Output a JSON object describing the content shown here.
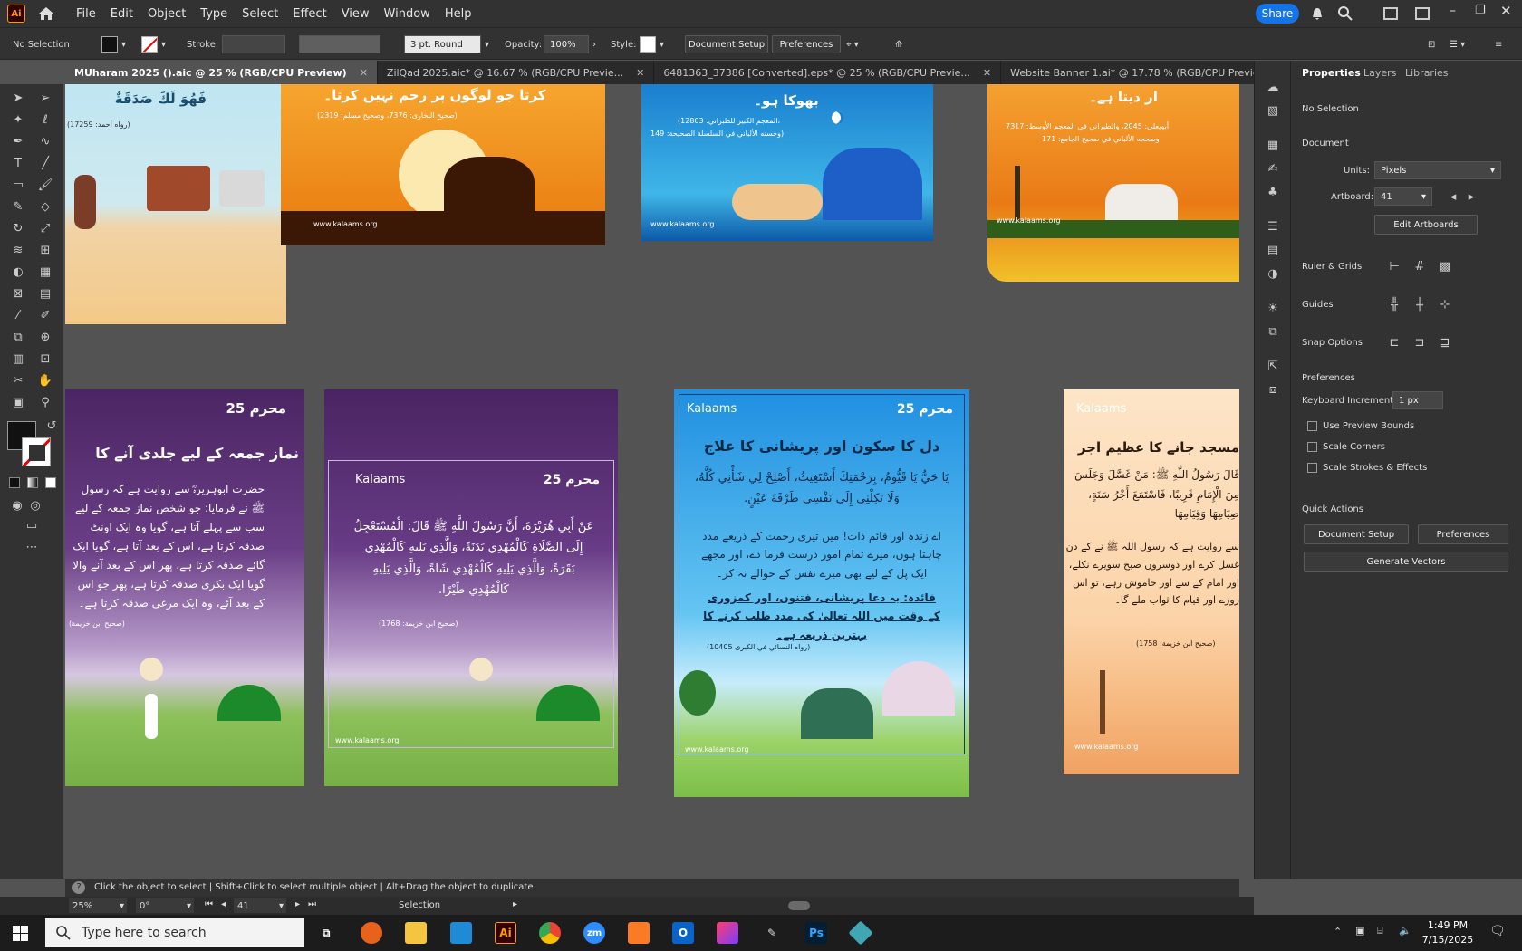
{
  "app": {
    "logo": "Ai",
    "share_label": "Share"
  },
  "menu": [
    "File",
    "Edit",
    "Object",
    "Type",
    "Select",
    "Effect",
    "View",
    "Window",
    "Help"
  ],
  "control": {
    "selection": "No Selection",
    "stroke_label": "Stroke:",
    "brush": "3 pt. Round",
    "opacity_label": "Opacity:",
    "opacity_value": "100%",
    "style_label": "Style:",
    "doc_setup": "Document Setup",
    "preferences": "Preferences"
  },
  "tabs": [
    {
      "label": "MUharam 2025 ().aic @ 25 % (RGB/CPU Preview)",
      "active": true
    },
    {
      "label": "ZilQad 2025.aic* @ 16.67 % (RGB/CPU Previe...",
      "active": false
    },
    {
      "label": "6481363_37386 [Converted].eps* @ 25 % (RGB/CPU Previe...",
      "active": false
    },
    {
      "label": "Website Banner 1.ai* @ 17.78 % (RGB/CPU Previe...",
      "active": false
    }
  ],
  "artboards": {
    "top1": {
      "text": "فَهُوَ لَكَ صَدَقَةٌ",
      "ref": "(رواه أحمد: 17259)"
    },
    "top2": {
      "text": "کرتا جو لوگوں پر رحم نہیں کرتا۔",
      "ref": "(صحیح البخاری: 7376، وصحیح مسلم: 2319)",
      "site": "www.kalaams.org"
    },
    "top3": {
      "text": "بھوکا ہو۔",
      "ref1": "(المعجم الكبير للطبراني: 12803،",
      "ref2": "وحسنه الألباني في السلسلة الصحيحة: 149)",
      "site": "www.kalaams.org"
    },
    "top4": {
      "text": "ار دیتا ہے۔",
      "ref1": "أبويعلى: 2045، والطبراني في المعجم الأوسط: 7317",
      "ref2": "وصححه الألباني في صحيح الجامع: 171",
      "site": "www.kalaams.org"
    },
    "b1": {
      "brand": "محرم 25",
      "title": "نماز جمعہ کے لیے جلدی آنے کا",
      "body": "حضرت ابوہریرہؓ سے روایت ہے کہ رسول ﷺ نے فرمایا: جو شخص نماز جمعہ کے لیے سب سے پہلے آتا ہے، گویا وہ ایک اونٹ صدقہ کرتا ہے، اس کے بعد آتا ہے، گویا ایک گائے صدقہ کرتا ہے، پھر اس کے بعد آنے والا گویا ایک بکری صدقہ کرتا ہے، پھر جو اس کے بعد آئے، وہ ایک مرغی صدقہ کرتا ہے۔",
      "ref": "(صحیح ابن خزیمة)"
    },
    "b2": {
      "brand": "Kalaams",
      "brand2": "محرم 25",
      "body": "عَنْ أَبِي هُرَيْرَةَ، أَنَّ رَسُولَ اللَّهِ ﷺ قَالَ: الْمُسْتَعْجِلُ إِلَى الصَّلَاةِ كَالْمُهْدِي بَدَنَةً، وَالَّذِي يَلِيهِ كَالْمُهْدِي بَقَرَةً، وَالَّذِي يَلِيهِ كَالْمُهْدِي شَاةً، وَالَّذِي يَلِيهِ كَالْمُهْدِي طَيْرًا.",
      "ref": "(صحیح ابن خزیمة: 1768)",
      "site": "www.kalaams.org"
    },
    "b3": {
      "brand": "Kalaams",
      "brand2": "محرم 25",
      "title": "دل کا سکون اور پریشانی کا علاج",
      "arabic": "يَا حَيُّ يَا قَيُّومُ، بِرَحْمَتِكَ أَسْتَغِيثُ، أَصْلِحْ لِي شَأْنِي كُلَّهُ، وَلَا تَكِلْنِي إِلَى نَفْسِي طَرْفَةَ عَيْنٍ.",
      "urdu": "اے زندہ اور قائم ذات! میں تیری رحمت کے ذریعے مدد چاہتا ہوں، میرے تمام امور درست فرما دے، اور مجھے ایک پل کے لیے بھی میرے نفس کے حوالے نہ کر۔",
      "benefit": "فائدہ: یہ دعا پریشانی، فتنوں، اور کمزوری کے وقت میں اللہ تعالیٰ کی مدد طلب کرنے کا بہترین ذریعہ ہے۔",
      "ref": "(رواه النسائي في الكبرى 10405)",
      "site": "www.kalaams.org"
    },
    "b4": {
      "brand": "Kalaams",
      "title": "مسجد جانے کا عظیم اجر",
      "arabic": "قَالَ رَسُولُ اللَّهِ ﷺ: مَنْ غَسَّلَ وَجَلَسَ مِنَ الْإِمَامِ قَرِيبًا، فَاسْتَمَعَ أَجْرُ سَنَةٍ، صِيَامِهَا وَقِيَامِهَا",
      "urdu": "سے روایت ہے کہ رسول اللہ ﷺ نے کے دن غسل کرے اور دوسروں صبح سویرے نکلے، اور امام کے سے اور خاموش رہے، تو اس روزے اور قیام کا ثواب ملے گا۔",
      "ref": "(صحیح ابن خزیمة: 1758)",
      "site": "www.kalaams.org"
    }
  },
  "panel": {
    "tabs": [
      "Properties",
      "Layers",
      "Libraries"
    ],
    "no_selection": "No Selection",
    "document": "Document",
    "units_label": "Units:",
    "units_value": "Pixels",
    "artboard_label": "Artboard:",
    "artboard_value": "41",
    "edit_artboards": "Edit Artboards",
    "ruler_grids": "Ruler & Grids",
    "guides": "Guides",
    "snap_options": "Snap Options",
    "preferences": "Preferences",
    "keyboard_increment_label": "Keyboard Increment:",
    "keyboard_increment_value": "1 px",
    "checkboxes": [
      "Use Preview Bounds",
      "Scale Corners",
      "Scale Strokes & Effects"
    ],
    "quick_actions": "Quick Actions",
    "qa_doc_setup": "Document Setup",
    "qa_preferences": "Preferences",
    "qa_generate": "Generate Vectors"
  },
  "status": {
    "hint": "Click the object to select  |  Shift+Click to select multiple object  |  Alt+Drag the object to duplicate",
    "zoom": "25%",
    "rotation": "0°",
    "artboard": "41",
    "tool": "Selection"
  },
  "taskbar": {
    "search_placeholder": "Type here to search",
    "time": "1:49 PM",
    "date": "7/15/2025"
  },
  "colors": {
    "accent": "#1473e6",
    "ai_orange": "#ff9a00"
  }
}
